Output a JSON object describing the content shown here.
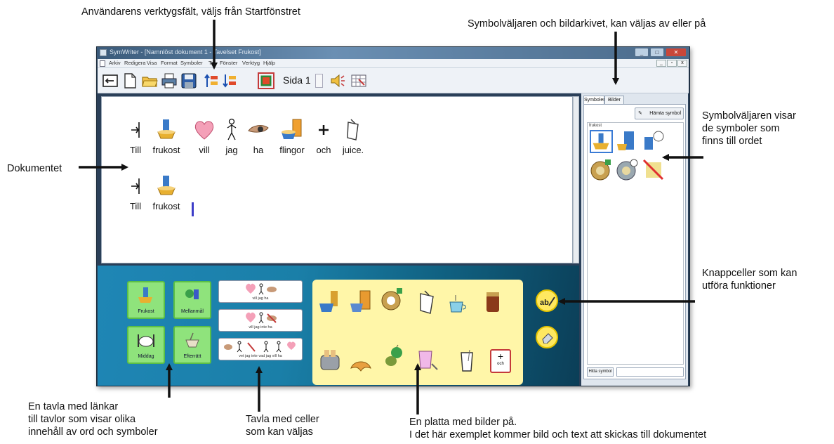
{
  "annotations": {
    "toolbar_note": "Användarens verktygsfält, väljs från Startfönstret",
    "symbolchooser_note": "Symbolväljaren och bildarkivet, kan väljas av eller på",
    "symbols_note": "Symbolväljaren visar\nde symboler som\nfinns till ordet",
    "document_note": "Dokumentet",
    "buttons_note": "Knappceller som kan\nutföra funktioner",
    "linkboard_note": "En tavla med länkar\ntill tavlor som visar olika\ninnehåll av ord och symboler",
    "cellboard_note": "Tavla med celler\nsom kan väljas",
    "picboard_note": "En platta med bilder på.\nI det här exemplet kommer bild och text att skickas till dokumentet"
  },
  "window": {
    "title": "SymWriter - [Namnlöst dokument 1 - Tavelset Frukost]",
    "menu": [
      "Arkiv",
      "Redigera",
      "Visa",
      "Format",
      "Symboler",
      "Tal",
      "Fönster",
      "Verktyg",
      "Hjälp"
    ]
  },
  "toolbar": {
    "page_label": "Sida 1",
    "icons": [
      "return-icon",
      "new-document-icon",
      "open-folder-icon",
      "print-icon",
      "save-icon",
      "symbols-up-icon",
      "symbols-down-icon",
      "image-icon",
      "speaker-icon",
      "grid-icon"
    ]
  },
  "document": {
    "line1": [
      "Till",
      "frukost",
      "vill",
      "jag",
      "ha",
      "flingor",
      "och",
      "juice."
    ],
    "line2": [
      "Till",
      "frukost"
    ]
  },
  "side_panel": {
    "tabs": [
      "Symboler",
      "Bilder"
    ],
    "fetch_button": "Hämta symbol",
    "list_header": "frukost",
    "find_button": "Hitta symbol"
  },
  "link_board": {
    "cells": [
      "Frukost",
      "Mellanmål",
      "Middag",
      "Efterrätt"
    ]
  },
  "cell_board": {
    "rows": [
      "vill  jag  ha",
      "vill  jag  inte ha",
      "vet  jag  inte  vad  jag  vill ha"
    ]
  },
  "picture_board": {
    "och_label": "och"
  },
  "colors": {
    "board_bg": "#1a7fa8",
    "link_cell": "#8fe37c",
    "picture_board": "#fff6a8",
    "function_button": "#ffe860"
  }
}
